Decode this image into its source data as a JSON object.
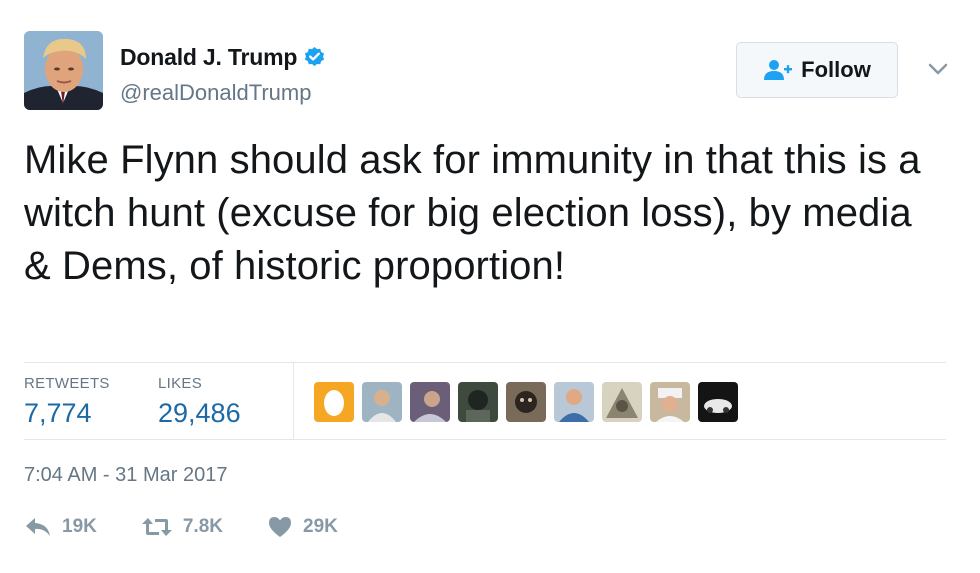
{
  "author": {
    "display_name": "Donald J. Trump",
    "handle": "@realDonaldTrump",
    "verified": true
  },
  "follow_label": "Follow",
  "tweet_text": "Mike Flynn should ask for immunity in that this is a witch hunt (excuse for big election loss), by media & Dems, of historic proportion!",
  "stats": {
    "retweets_label": "RETWEETS",
    "retweets_value": "7,774",
    "likes_label": "LIKES",
    "likes_value": "29,486"
  },
  "timestamp": "7:04 AM - 31 Mar 2017",
  "actions": {
    "reply_count": "19K",
    "retweet_count": "7.8K",
    "like_count": "29K"
  },
  "colors": {
    "link_blue": "#1b6aa5",
    "verified_blue": "#1da1f2",
    "muted_gray": "#657786",
    "icon_gray": "#8899a6"
  }
}
